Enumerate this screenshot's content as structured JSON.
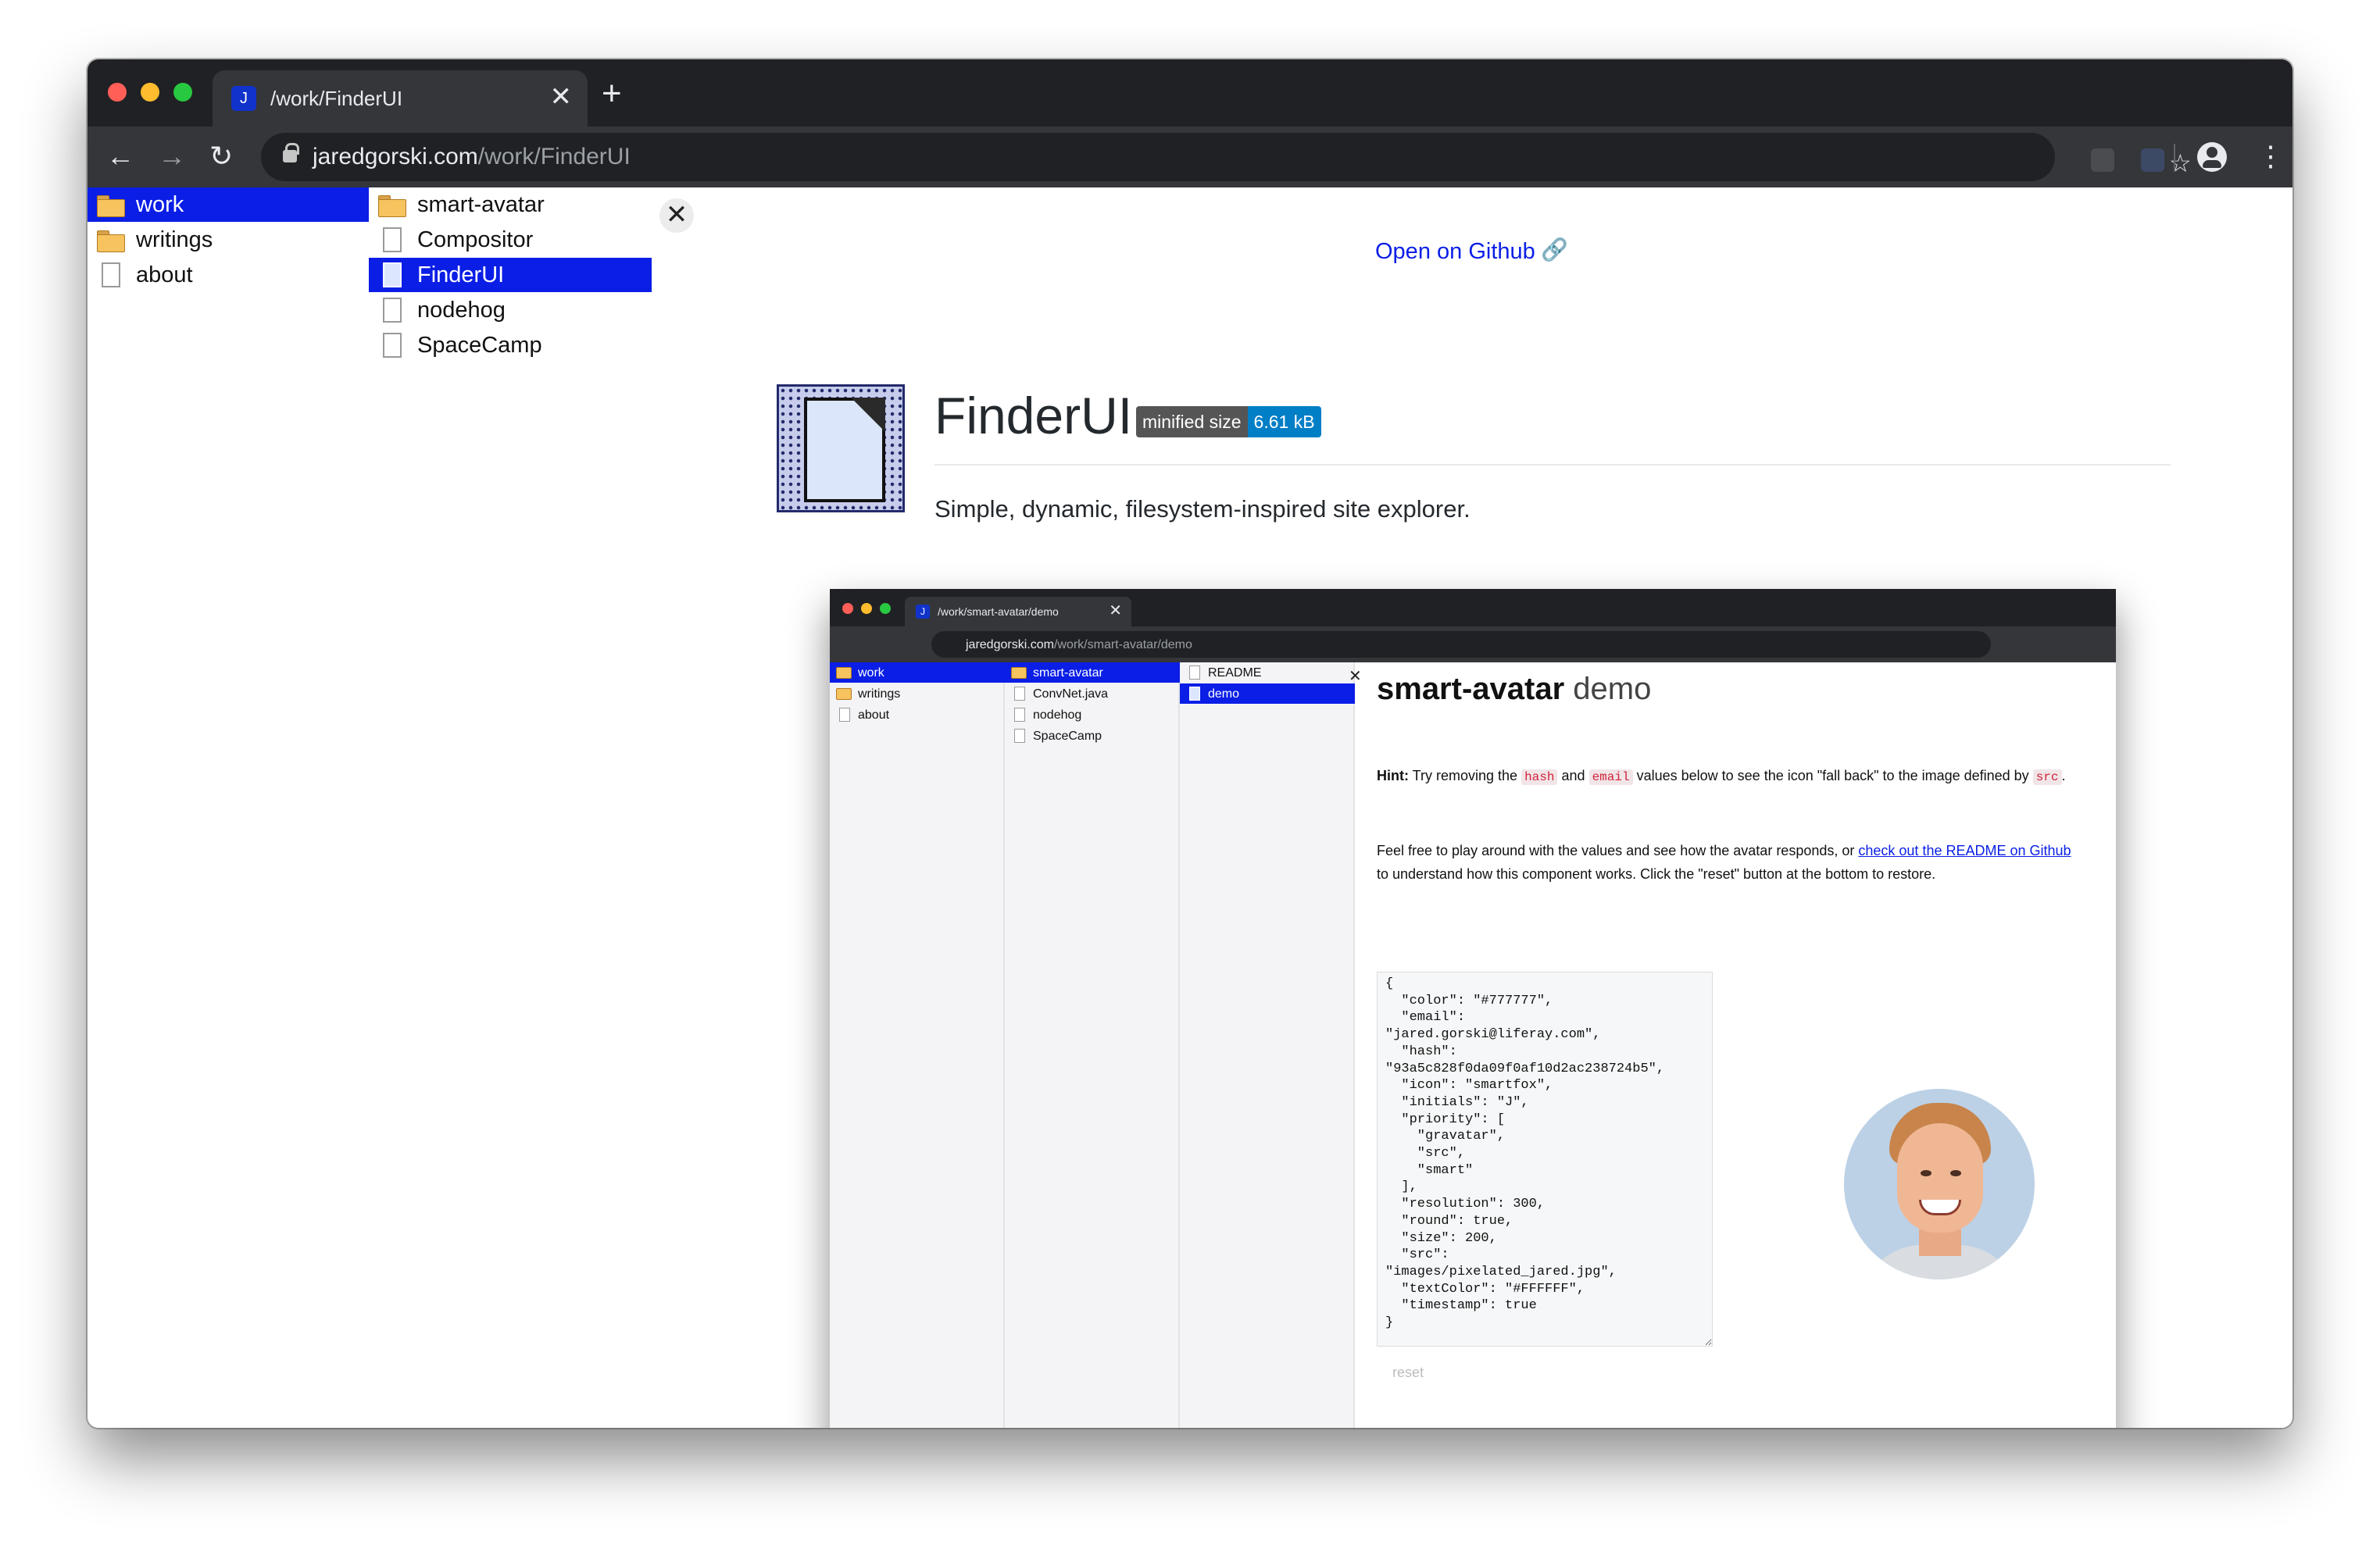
{
  "browser": {
    "tab": {
      "favicon_letter": "J",
      "title": "/work/FinderUI",
      "close": "✕"
    },
    "new_tab": "+",
    "nav": {
      "back": "←",
      "forward": "→",
      "reload": "↻"
    },
    "url": {
      "host": "jaredgorski.com",
      "path": "/work/FinderUI"
    },
    "star": "☆",
    "menu": "⋮"
  },
  "finder": {
    "col1": [
      {
        "label": "work",
        "type": "folder",
        "selected": true
      },
      {
        "label": "writings",
        "type": "folder",
        "selected": false
      },
      {
        "label": "about",
        "type": "file",
        "selected": false
      }
    ],
    "col2": [
      {
        "label": "smart-avatar",
        "type": "folder",
        "selected": false
      },
      {
        "label": "Compositor",
        "type": "file",
        "selected": false
      },
      {
        "label": "FinderUI",
        "type": "file",
        "selected": true
      },
      {
        "label": "nodehog",
        "type": "file",
        "selected": false
      },
      {
        "label": "SpaceCamp",
        "type": "file",
        "selected": false
      }
    ],
    "close": "✕"
  },
  "readme": {
    "github_link": "Open on Github",
    "link_icon": "🔗",
    "title": "FinderUI",
    "badge": {
      "label": "minified size",
      "value": "6.61 kB"
    },
    "description": "Simple, dynamic, filesystem-inspired site explorer."
  },
  "screenshot": {
    "tab": {
      "favicon_letter": "J",
      "title": "/work/smart-avatar/demo",
      "close": "✕"
    },
    "url": {
      "host": "jaredgorski.com",
      "path": "/work/smart-avatar/demo"
    },
    "col1": [
      {
        "label": "work",
        "type": "folder",
        "selected": true
      },
      {
        "label": "writings",
        "type": "folder",
        "selected": false
      },
      {
        "label": "about",
        "type": "file",
        "selected": false
      }
    ],
    "col2": [
      {
        "label": "smart-avatar",
        "type": "folder",
        "selected": true
      },
      {
        "label": "ConvNet.java",
        "type": "file",
        "selected": false
      },
      {
        "label": "nodehog",
        "type": "file",
        "selected": false
      },
      {
        "label": "SpaceCamp",
        "type": "file",
        "selected": false
      }
    ],
    "col3": [
      {
        "label": "README",
        "type": "file",
        "selected": false
      },
      {
        "label": "demo",
        "type": "file",
        "selected": true
      }
    ],
    "close": "✕",
    "heading_bold": "smart-avatar",
    "heading_rest": "demo",
    "hint_label": "Hint:",
    "hint_1": "Try removing the",
    "hint_code_1": "hash",
    "hint_2": "and",
    "hint_code_2": "email",
    "hint_3": "values below to see the icon \"fall back\" to the image defined by",
    "hint_code_3": "src",
    "hint_4": ".",
    "para2_1": "Feel free to play around with the values and see how the avatar responds, or",
    "para2_link": "check out the README on Github",
    "para2_2": "to understand how this component works. Click the \"reset\" button at the bottom to restore.",
    "json_text": "{\n  \"color\": \"#777777\",\n  \"email\":\n\"jared.gorski@liferay.com\",\n  \"hash\":\n\"93a5c828f0da09f0af10d2ac238724b5\",\n  \"icon\": \"smartfox\",\n  \"initials\": \"J\",\n  \"priority\": [\n    \"gravatar\",\n    \"src\",\n    \"smart\"\n  ],\n  \"resolution\": 300,\n  \"round\": true,\n  \"size\": 200,\n  \"src\":\n\"images/pixelated_jared.jpg\",\n  \"textColor\": \"#FFFFFF\",\n  \"timestamp\": true\n}",
    "reset": "reset"
  },
  "colors": {
    "selection": "#0a1ee6",
    "traffic_red": "#ff5f57",
    "traffic_yellow": "#febc2e",
    "traffic_green": "#28c840",
    "badge_left": "#555555",
    "badge_right": "#007ec6",
    "link": "#0a1ee6"
  }
}
